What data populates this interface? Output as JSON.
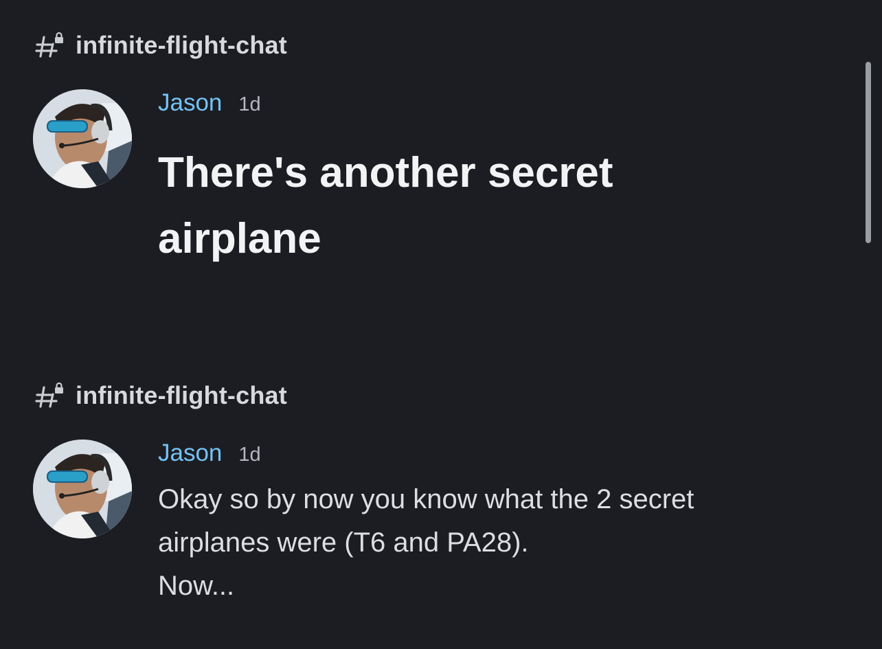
{
  "feed": {
    "items": [
      {
        "channel": "infinite-flight-chat",
        "author": "Jason",
        "time": "1d",
        "headline": "There's another secret airplane",
        "headline_lines": [
          "There's another secret",
          "airplane"
        ]
      },
      {
        "channel": "infinite-flight-chat",
        "author": "Jason",
        "time": "1d",
        "lines": [
          "Okay so by now you know what the 2 secret",
          "airplanes were (T6 and PA28).",
          "Now..."
        ]
      }
    ]
  },
  "icons": {
    "channel": "locked-hashtag-icon",
    "avatar": "avatar-pilot-headset"
  },
  "colors": {
    "background": "#1c1d22",
    "author": "#74c3f5",
    "text": "#dcdee1",
    "muted": "#b5b9bf"
  }
}
